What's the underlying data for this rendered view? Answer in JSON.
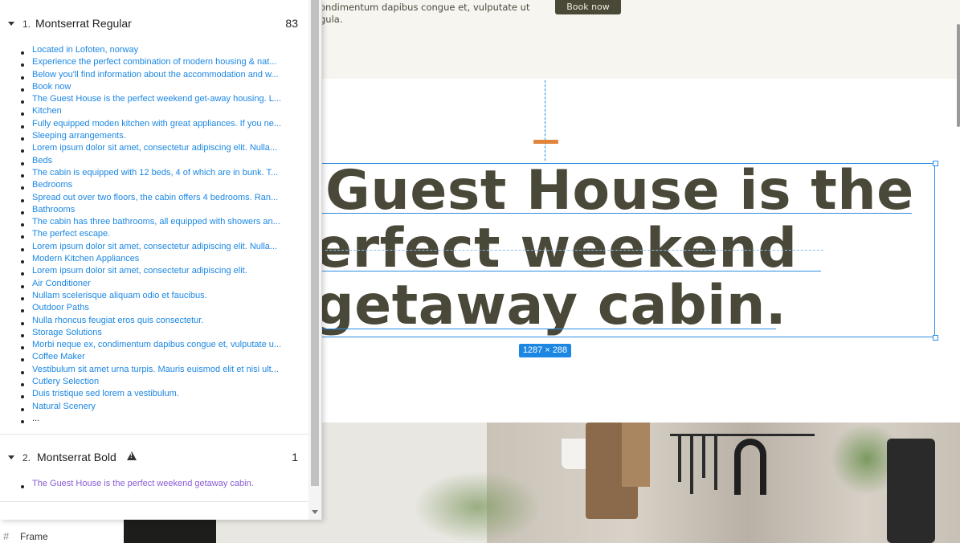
{
  "canvas": {
    "top_text_line1": "ondimentum dapibus congue et, vulputate ut",
    "top_text_line2": "gula.",
    "book_button": "Book now",
    "heading_line1": "Guest House is the",
    "heading_line2": "erfect weekend",
    "heading_line3": "getaway cabin.",
    "dimension_badge": "1287 × 288",
    "layer_name": "Frame"
  },
  "font_panel": {
    "groups": [
      {
        "number": "1.",
        "name": "Montserrat Regular",
        "count": "83",
        "items": [
          "Located in Lofoten, norway",
          "Experience the perfect combination of modern housing & nat...",
          "Below you'll find information about the accommodation and w...",
          "Book now",
          "The Guest House is the perfect weekend get-away housing. L...",
          "Kitchen",
          "Fully equipped moden kitchen with great appliances. If you ne...",
          "Sleeping arrangements.",
          "Lorem ipsum dolor sit amet, consectetur adipiscing elit. Nulla...",
          "Beds",
          "The cabin is equipped with 12 beds, 4 of which are in bunk. T...",
          "Bedrooms",
          "Spread out over two floors, the cabin offers 4 bedrooms. Ran...",
          "Bathrooms",
          "The cabin has three bathrooms, all equipped with showers an...",
          "The perfect escape.",
          "Lorem ipsum dolor sit amet, consectetur adipiscing elit. Nulla...",
          "Modern Kitchen Appliances",
          "Lorem ipsum dolor sit amet, consectetur adipiscing elit.",
          "Air Conditioner",
          "Nullam scelerisque aliquam odio et faucibus.",
          "Outdoor Paths",
          "Nulla rhoncus feugiat eros quis consectetur.",
          "Storage Solutions",
          "Morbi neque ex, condimentum dapibus congue et, vulputate u...",
          "Coffee Maker",
          "Vestibulum sit amet urna turpis. Mauris euismod elit et nisi ult...",
          "Cutlery Selection",
          "Duis tristique sed lorem a vestibulum.",
          "Natural Scenery"
        ],
        "more": "..."
      },
      {
        "number": "2.",
        "name": "Montserrat Bold",
        "count": "1",
        "warning_icon": "warning-icon",
        "items": [
          "The Guest House is the perfect weekend getaway cabin."
        ]
      }
    ]
  },
  "colors": {
    "accent_blue": "#1b87e3",
    "heading_text": "#4a4838",
    "orange_mark": "#e1843c",
    "bold_item": "#8a5cd6"
  }
}
